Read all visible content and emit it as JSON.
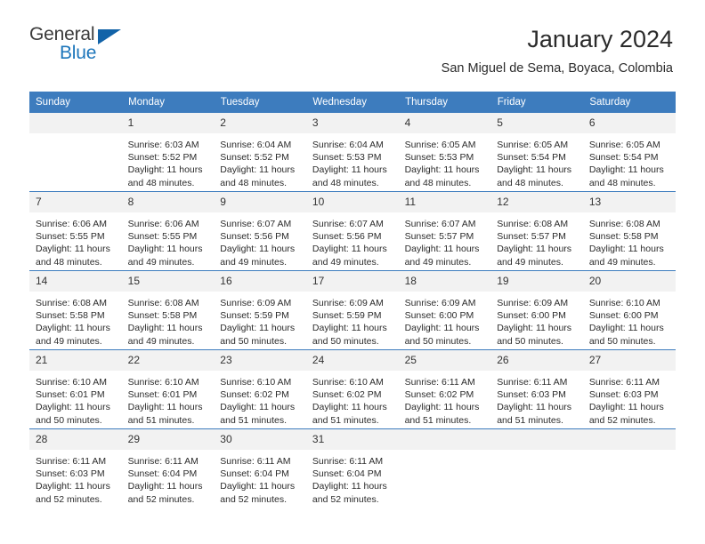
{
  "brand": {
    "name_top": "General",
    "name_bottom": "Blue",
    "triangle_color": "#1263a8",
    "blue_color": "#1d76bb"
  },
  "header": {
    "title": "January 2024",
    "subtitle": "San Miguel de Sema, Boyaca, Colombia",
    "accent_color": "#3d7cbe",
    "daynum_band_color": "#f2f2f2"
  },
  "weekday_headers": [
    "Sunday",
    "Monday",
    "Tuesday",
    "Wednesday",
    "Thursday",
    "Friday",
    "Saturday"
  ],
  "labels": {
    "sunrise_prefix": "Sunrise: ",
    "sunset_prefix": "Sunset: ",
    "daylight_prefix": "Daylight: "
  },
  "weeks": [
    [
      {
        "day": "",
        "sunrise": "",
        "sunset": "",
        "daylight_line1": "",
        "daylight_line2": ""
      },
      {
        "day": "1",
        "sunrise": "Sunrise: 6:03 AM",
        "sunset": "Sunset: 5:52 PM",
        "daylight_line1": "Daylight: 11 hours",
        "daylight_line2": "and 48 minutes."
      },
      {
        "day": "2",
        "sunrise": "Sunrise: 6:04 AM",
        "sunset": "Sunset: 5:52 PM",
        "daylight_line1": "Daylight: 11 hours",
        "daylight_line2": "and 48 minutes."
      },
      {
        "day": "3",
        "sunrise": "Sunrise: 6:04 AM",
        "sunset": "Sunset: 5:53 PM",
        "daylight_line1": "Daylight: 11 hours",
        "daylight_line2": "and 48 minutes."
      },
      {
        "day": "4",
        "sunrise": "Sunrise: 6:05 AM",
        "sunset": "Sunset: 5:53 PM",
        "daylight_line1": "Daylight: 11 hours",
        "daylight_line2": "and 48 minutes."
      },
      {
        "day": "5",
        "sunrise": "Sunrise: 6:05 AM",
        "sunset": "Sunset: 5:54 PM",
        "daylight_line1": "Daylight: 11 hours",
        "daylight_line2": "and 48 minutes."
      },
      {
        "day": "6",
        "sunrise": "Sunrise: 6:05 AM",
        "sunset": "Sunset: 5:54 PM",
        "daylight_line1": "Daylight: 11 hours",
        "daylight_line2": "and 48 minutes."
      }
    ],
    [
      {
        "day": "7",
        "sunrise": "Sunrise: 6:06 AM",
        "sunset": "Sunset: 5:55 PM",
        "daylight_line1": "Daylight: 11 hours",
        "daylight_line2": "and 48 minutes."
      },
      {
        "day": "8",
        "sunrise": "Sunrise: 6:06 AM",
        "sunset": "Sunset: 5:55 PM",
        "daylight_line1": "Daylight: 11 hours",
        "daylight_line2": "and 49 minutes."
      },
      {
        "day": "9",
        "sunrise": "Sunrise: 6:07 AM",
        "sunset": "Sunset: 5:56 PM",
        "daylight_line1": "Daylight: 11 hours",
        "daylight_line2": "and 49 minutes."
      },
      {
        "day": "10",
        "sunrise": "Sunrise: 6:07 AM",
        "sunset": "Sunset: 5:56 PM",
        "daylight_line1": "Daylight: 11 hours",
        "daylight_line2": "and 49 minutes."
      },
      {
        "day": "11",
        "sunrise": "Sunrise: 6:07 AM",
        "sunset": "Sunset: 5:57 PM",
        "daylight_line1": "Daylight: 11 hours",
        "daylight_line2": "and 49 minutes."
      },
      {
        "day": "12",
        "sunrise": "Sunrise: 6:08 AM",
        "sunset": "Sunset: 5:57 PM",
        "daylight_line1": "Daylight: 11 hours",
        "daylight_line2": "and 49 minutes."
      },
      {
        "day": "13",
        "sunrise": "Sunrise: 6:08 AM",
        "sunset": "Sunset: 5:58 PM",
        "daylight_line1": "Daylight: 11 hours",
        "daylight_line2": "and 49 minutes."
      }
    ],
    [
      {
        "day": "14",
        "sunrise": "Sunrise: 6:08 AM",
        "sunset": "Sunset: 5:58 PM",
        "daylight_line1": "Daylight: 11 hours",
        "daylight_line2": "and 49 minutes."
      },
      {
        "day": "15",
        "sunrise": "Sunrise: 6:08 AM",
        "sunset": "Sunset: 5:58 PM",
        "daylight_line1": "Daylight: 11 hours",
        "daylight_line2": "and 49 minutes."
      },
      {
        "day": "16",
        "sunrise": "Sunrise: 6:09 AM",
        "sunset": "Sunset: 5:59 PM",
        "daylight_line1": "Daylight: 11 hours",
        "daylight_line2": "and 50 minutes."
      },
      {
        "day": "17",
        "sunrise": "Sunrise: 6:09 AM",
        "sunset": "Sunset: 5:59 PM",
        "daylight_line1": "Daylight: 11 hours",
        "daylight_line2": "and 50 minutes."
      },
      {
        "day": "18",
        "sunrise": "Sunrise: 6:09 AM",
        "sunset": "Sunset: 6:00 PM",
        "daylight_line1": "Daylight: 11 hours",
        "daylight_line2": "and 50 minutes."
      },
      {
        "day": "19",
        "sunrise": "Sunrise: 6:09 AM",
        "sunset": "Sunset: 6:00 PM",
        "daylight_line1": "Daylight: 11 hours",
        "daylight_line2": "and 50 minutes."
      },
      {
        "day": "20",
        "sunrise": "Sunrise: 6:10 AM",
        "sunset": "Sunset: 6:00 PM",
        "daylight_line1": "Daylight: 11 hours",
        "daylight_line2": "and 50 minutes."
      }
    ],
    [
      {
        "day": "21",
        "sunrise": "Sunrise: 6:10 AM",
        "sunset": "Sunset: 6:01 PM",
        "daylight_line1": "Daylight: 11 hours",
        "daylight_line2": "and 50 minutes."
      },
      {
        "day": "22",
        "sunrise": "Sunrise: 6:10 AM",
        "sunset": "Sunset: 6:01 PM",
        "daylight_line1": "Daylight: 11 hours",
        "daylight_line2": "and 51 minutes."
      },
      {
        "day": "23",
        "sunrise": "Sunrise: 6:10 AM",
        "sunset": "Sunset: 6:02 PM",
        "daylight_line1": "Daylight: 11 hours",
        "daylight_line2": "and 51 minutes."
      },
      {
        "day": "24",
        "sunrise": "Sunrise: 6:10 AM",
        "sunset": "Sunset: 6:02 PM",
        "daylight_line1": "Daylight: 11 hours",
        "daylight_line2": "and 51 minutes."
      },
      {
        "day": "25",
        "sunrise": "Sunrise: 6:11 AM",
        "sunset": "Sunset: 6:02 PM",
        "daylight_line1": "Daylight: 11 hours",
        "daylight_line2": "and 51 minutes."
      },
      {
        "day": "26",
        "sunrise": "Sunrise: 6:11 AM",
        "sunset": "Sunset: 6:03 PM",
        "daylight_line1": "Daylight: 11 hours",
        "daylight_line2": "and 51 minutes."
      },
      {
        "day": "27",
        "sunrise": "Sunrise: 6:11 AM",
        "sunset": "Sunset: 6:03 PM",
        "daylight_line1": "Daylight: 11 hours",
        "daylight_line2": "and 52 minutes."
      }
    ],
    [
      {
        "day": "28",
        "sunrise": "Sunrise: 6:11 AM",
        "sunset": "Sunset: 6:03 PM",
        "daylight_line1": "Daylight: 11 hours",
        "daylight_line2": "and 52 minutes."
      },
      {
        "day": "29",
        "sunrise": "Sunrise: 6:11 AM",
        "sunset": "Sunset: 6:04 PM",
        "daylight_line1": "Daylight: 11 hours",
        "daylight_line2": "and 52 minutes."
      },
      {
        "day": "30",
        "sunrise": "Sunrise: 6:11 AM",
        "sunset": "Sunset: 6:04 PM",
        "daylight_line1": "Daylight: 11 hours",
        "daylight_line2": "and 52 minutes."
      },
      {
        "day": "31",
        "sunrise": "Sunrise: 6:11 AM",
        "sunset": "Sunset: 6:04 PM",
        "daylight_line1": "Daylight: 11 hours",
        "daylight_line2": "and 52 minutes."
      },
      {
        "day": "",
        "sunrise": "",
        "sunset": "",
        "daylight_line1": "",
        "daylight_line2": ""
      },
      {
        "day": "",
        "sunrise": "",
        "sunset": "",
        "daylight_line1": "",
        "daylight_line2": ""
      },
      {
        "day": "",
        "sunrise": "",
        "sunset": "",
        "daylight_line1": "",
        "daylight_line2": ""
      }
    ]
  ]
}
